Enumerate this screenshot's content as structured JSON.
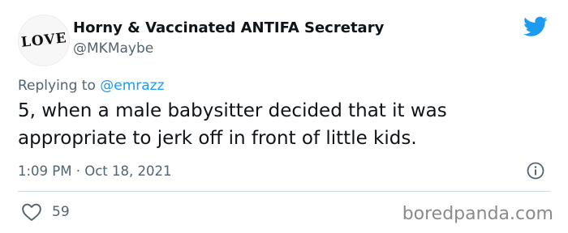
{
  "author": {
    "avatar_text": "LOVE",
    "display_name": "Horny & Vaccinated ANTIFA Secretary",
    "handle": "@MKMaybe"
  },
  "reply": {
    "prefix": "Replying to ",
    "mention": "@emrazz"
  },
  "tweet": {
    "text": "5, when a male babysitter decided that it was appropriate to jerk off in front of little kids.",
    "timestamp": "1:09 PM · Oct 18, 2021",
    "likes": "59"
  },
  "watermark": "boredpanda.com",
  "icons": {
    "brand": "twitter-bird-icon",
    "info": "info-icon",
    "like": "heart-icon"
  },
  "colors": {
    "brand": "#1d9bf0",
    "secondary_text": "#536471",
    "primary_text": "#0f1419"
  }
}
